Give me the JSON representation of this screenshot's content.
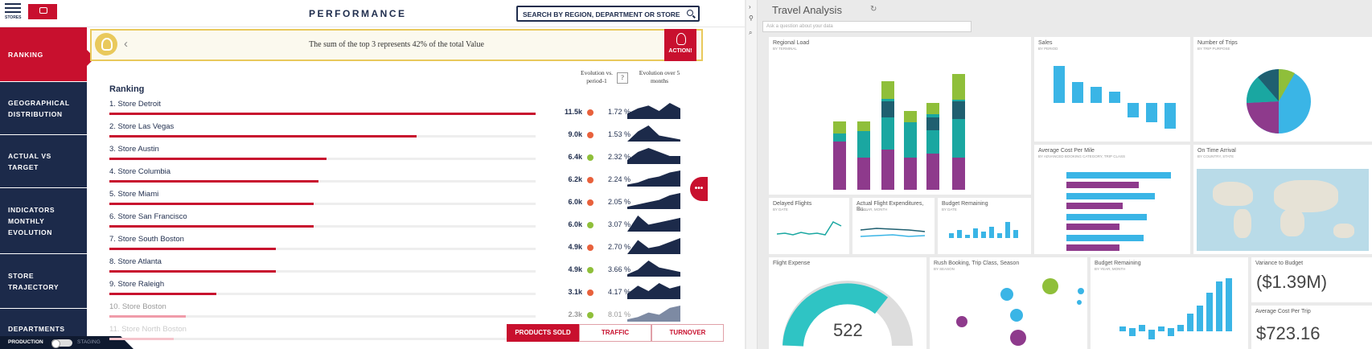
{
  "left_app": {
    "logo_text": "STORES",
    "title": "PERFORMANCE",
    "search_label": "SEARCH BY REGION, DEPARTMENT OR STORE",
    "nav": [
      {
        "line1": "RANKING",
        "line2": "",
        "line3": "",
        "active": true
      },
      {
        "line1": "GEOGRAPHICAL",
        "line2": "DISTRIBUTION",
        "line3": "",
        "active": false
      },
      {
        "line1": "ACTUAL VS",
        "line2": "TARGET",
        "line3": "",
        "active": false
      },
      {
        "line1": "INDICATORS",
        "line2": "MONTHLY",
        "line3": "EVOLUTION",
        "active": false
      },
      {
        "line1": "STORE",
        "line2": "TRAJECTORY",
        "line3": "",
        "active": false
      },
      {
        "line1": "DEPARTMENTS",
        "line2": "",
        "line3": "",
        "active": false
      }
    ],
    "env": {
      "production": "PRODUCTION",
      "staging": "STAGING"
    },
    "banner": {
      "message": "The sum of the top 3 represents 42% of the total Value",
      "action_label": "ACTION!"
    },
    "ranking_title": "Ranking",
    "col_evolution": "Evolution vs. period-1",
    "col_period_box": "?",
    "col_evolution_5": "Evolution over 5 months",
    "stores": [
      {
        "label": "1. Store Detroit",
        "value": "11.5k",
        "share": 1.0,
        "trend": "down",
        "pct": "1.72 %",
        "spark": [
          2,
          4,
          5,
          3,
          6,
          4
        ]
      },
      {
        "label": "2. Store Las Vegas",
        "value": "9.0k",
        "share": 0.72,
        "trend": "down",
        "pct": "1.53 %",
        "spark": [
          0,
          5,
          8,
          3,
          2,
          1
        ]
      },
      {
        "label": "3. Store Austin",
        "value": "6.4k",
        "share": 0.51,
        "trend": "up",
        "pct": "2.32 %",
        "spark": [
          1,
          3,
          4,
          3,
          2,
          2
        ]
      },
      {
        "label": "4. Store Columbia",
        "value": "6.2k",
        "share": 0.49,
        "trend": "down",
        "pct": "2.24 %",
        "spark": [
          1,
          2,
          4,
          5,
          7,
          8
        ]
      },
      {
        "label": "5. Store Miami",
        "value": "6.0k",
        "share": 0.48,
        "trend": "down",
        "pct": "2.05 %",
        "spark": [
          1,
          2,
          3,
          4,
          6,
          7
        ]
      },
      {
        "label": "6. Store San Francisco",
        "value": "6.0k",
        "share": 0.48,
        "trend": "up",
        "pct": "3.07 %",
        "spark": [
          0,
          7,
          3,
          4,
          5,
          6
        ]
      },
      {
        "label": "7. Store South Boston",
        "value": "4.9k",
        "share": 0.39,
        "trend": "down",
        "pct": "2.70 %",
        "spark": [
          0,
          7,
          3,
          4,
          6,
          8
        ]
      },
      {
        "label": "8. Store Atlanta",
        "value": "4.9k",
        "share": 0.39,
        "trend": "up",
        "pct": "3.66 %",
        "spark": [
          1,
          3,
          7,
          4,
          3,
          2
        ]
      },
      {
        "label": "9. Store Raleigh",
        "value": "3.1k",
        "share": 0.25,
        "trend": "down",
        "pct": "4.17 %",
        "spark": [
          2,
          5,
          3,
          6,
          4,
          5
        ]
      },
      {
        "label": "10. Store Boston",
        "value": "2.3k",
        "share": 0.18,
        "trend": "up",
        "pct": "8.01 %",
        "spark": [
          1,
          2,
          4,
          3,
          6,
          7
        ]
      },
      {
        "label": "11. Store North Boston",
        "value": "",
        "share": 0.15,
        "trend": "up",
        "pct": "",
        "spark": []
      }
    ],
    "tabs": [
      {
        "label": "PRODUCTS SOLD",
        "active": true
      },
      {
        "label": "TRAFFIC",
        "active": false
      },
      {
        "label": "TURNOVER",
        "active": false
      }
    ],
    "more_button": "•••"
  },
  "right_app": {
    "title": "Travel Analysis",
    "qa_placeholder": "Ask a question about your data",
    "tiles": {
      "regional_load": {
        "title": "Regional Load",
        "subtitle": "BY TERMINAL"
      },
      "sales": {
        "title": "Sales",
        "subtitle": "BY PERIOD"
      },
      "trips": {
        "title": "Number of Trips",
        "subtitle": "BY TRIP PURPOSE"
      },
      "avg_cost_mile": {
        "title": "Average Cost Per Mile",
        "subtitle": "BY ADVANCED BOOKING CATEGORY, TRIP CLASS"
      },
      "on_time": {
        "title": "On Time Arrival",
        "subtitle": "BY COUNTRY, STATE"
      },
      "delayed": {
        "title": "Delayed Flights",
        "subtitle": "BY DATE"
      },
      "actual_exp": {
        "title": "Actual Flight Expenditures, Bu...",
        "subtitle": "BY YEAR, MONTH"
      },
      "budget_remaining_small": {
        "title": "Budget Remaining",
        "subtitle": "BY DATE"
      },
      "flight_expense": {
        "title": "Flight Expense",
        "value": "522"
      },
      "rush": {
        "title": "Rush Booking, Trip Class, Season",
        "subtitle": "BY SEASON"
      },
      "budget_remaining": {
        "title": "Budget Remaining",
        "subtitle": "BY YEAR, MONTH"
      },
      "variance": {
        "title": "Variance to Budget",
        "value": "($1.39M)"
      },
      "avg_cost_trip": {
        "title": "Average Cost Per Trip",
        "value": "$723.16"
      }
    },
    "colors": {
      "teal": "#1aa7a1",
      "green": "#8fbf3a",
      "purple": "#8e3a8c",
      "blue": "#3ab5e6",
      "dark": "#1f5f70"
    }
  }
}
